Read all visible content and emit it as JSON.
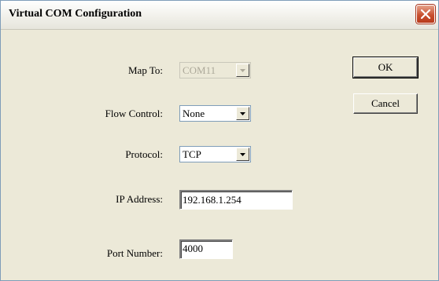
{
  "window": {
    "title": "Virtual COM Configuration"
  },
  "form": {
    "map_to": {
      "label": "Map To:",
      "value": "COM11"
    },
    "flow_control": {
      "label": "Flow Control:",
      "value": "None"
    },
    "protocol": {
      "label": "Protocol:",
      "value": "TCP"
    },
    "ip_address": {
      "label": "IP Address:",
      "value": "192.168.1.254"
    },
    "port_number": {
      "label": "Port Number:",
      "value": "4000"
    }
  },
  "buttons": {
    "ok": "OK",
    "cancel": "Cancel"
  },
  "icons": {
    "close": "close-icon",
    "dropdown": "chevron-down-icon"
  },
  "colors": {
    "close_button": "#c8502f",
    "dialog_background": "#ece9d8"
  }
}
